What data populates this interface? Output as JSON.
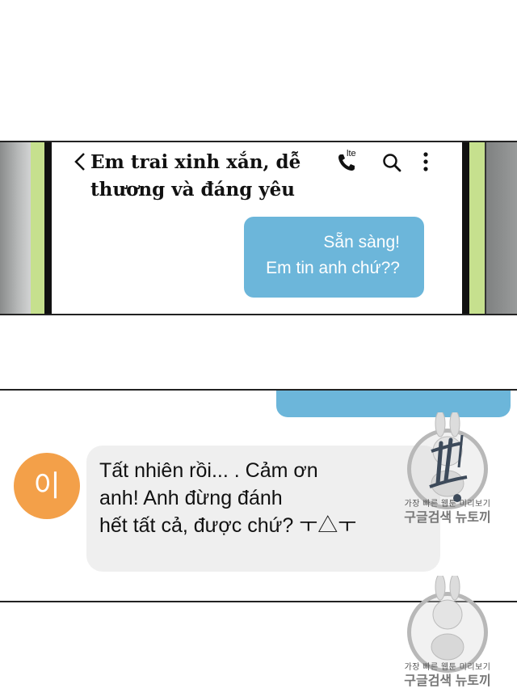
{
  "panel1": {
    "chat_header": {
      "contact_name_line1": "Em trai xinh xắn, dễ",
      "contact_name_line2": "thương và đáng yêu",
      "network_label": "lte",
      "icons": [
        "back-chevron-icon",
        "phone-call-icon",
        "search-icon",
        "more-vertical-icon"
      ]
    },
    "outgoing_message": {
      "line1": "Sẵn sàng!",
      "line2": "Em tin anh chứ??"
    }
  },
  "panel2": {
    "avatar_label": "이",
    "incoming_message": {
      "line1": "Tất nhiên rồi... . Cảm ơn",
      "line2": "anh! Anh đừng đánh",
      "line3": "hết tất cả, được chứ? ㅜ△ㅜ"
    }
  },
  "watermark": {
    "line1": "가장 빠른 웹툰 미리보기",
    "line2": "구글검색 뉴토끼"
  },
  "colors": {
    "outgoing_bubble": "#6cb6da",
    "incoming_bubble": "#efefef",
    "avatar": "#f3a049",
    "frame_green": "#c6e08e"
  }
}
